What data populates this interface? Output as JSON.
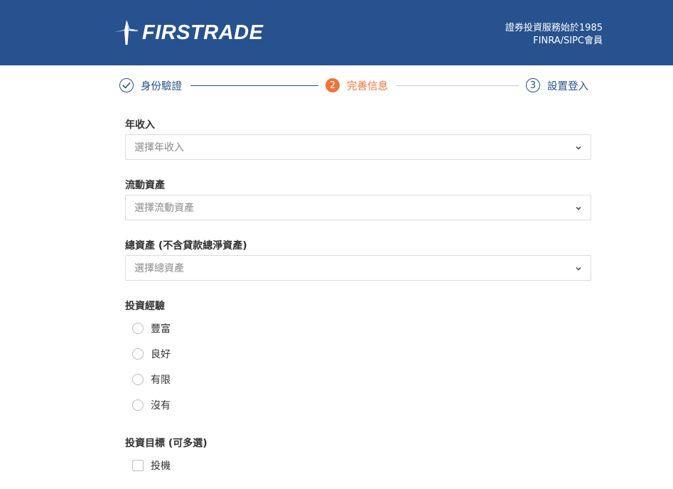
{
  "header": {
    "logo_text": "FIRSTRADE",
    "tagline_line1": "證券投資服務始於1985",
    "tagline_line2": "FINRA/SIPC會員"
  },
  "stepper": {
    "steps": [
      {
        "number": "",
        "label": "身份驗證",
        "state": "completed"
      },
      {
        "number": "2",
        "label": "完善信息",
        "state": "active"
      },
      {
        "number": "3",
        "label": "設置登入",
        "state": "pending"
      }
    ]
  },
  "form": {
    "annual_income": {
      "label": "年收入",
      "placeholder": "選擇年收入"
    },
    "liquid_assets": {
      "label": "流動資產",
      "placeholder": "選擇流動資產"
    },
    "total_assets": {
      "label": "總資產 (不含貸款總淨資產)",
      "placeholder": "選擇總資產"
    },
    "experience": {
      "label": "投資經驗",
      "options": [
        "豐富",
        "良好",
        "有限",
        "沒有"
      ]
    },
    "objectives": {
      "label": "投資目標 (可多選)",
      "options": [
        "投機"
      ]
    }
  },
  "colors": {
    "header_bg": "#27528f",
    "primary": "#27528f",
    "active_step": "#f0733a"
  }
}
